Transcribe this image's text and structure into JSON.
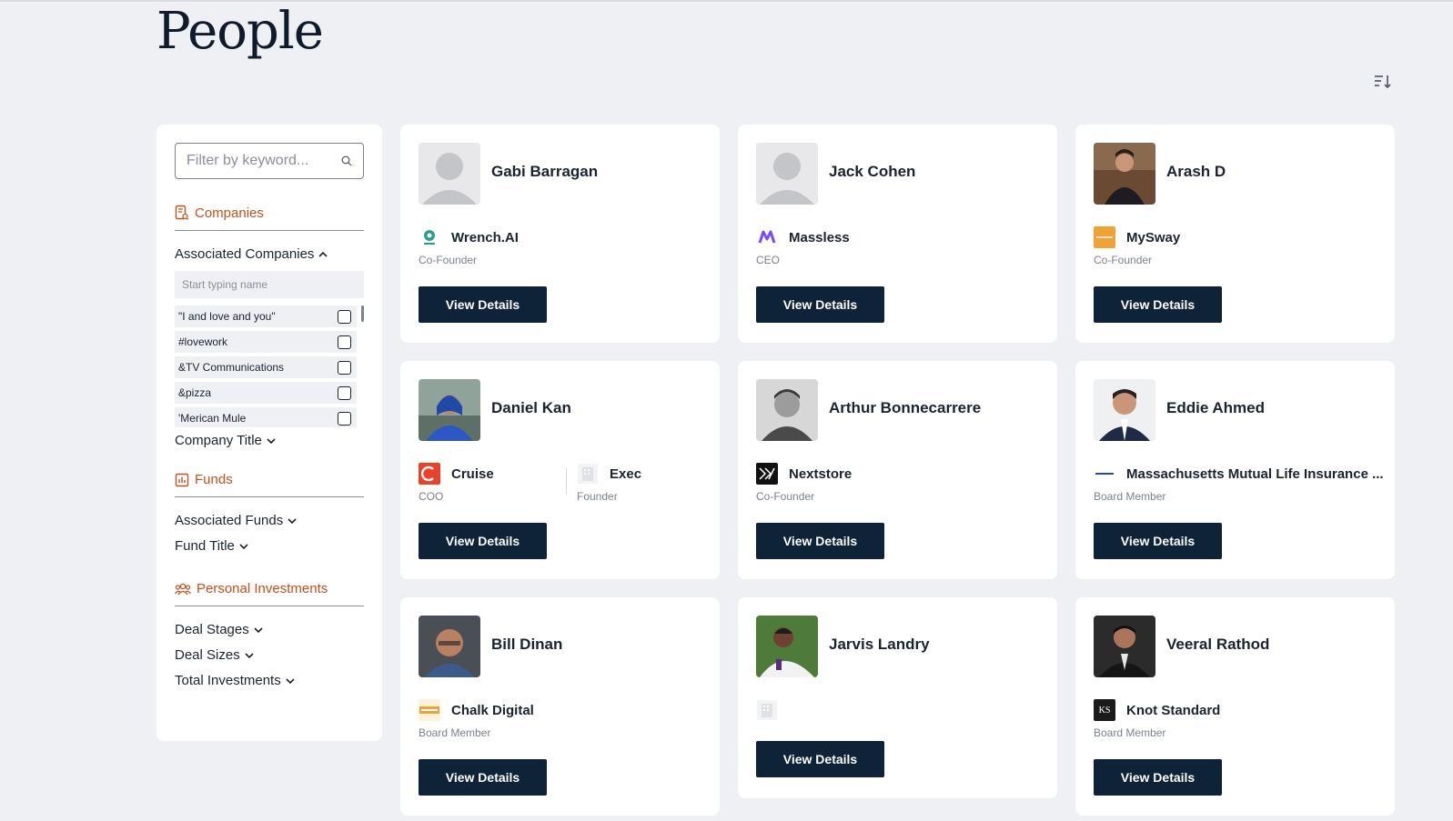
{
  "page": {
    "title": "People",
    "sort_icon": "sort-descending-icon"
  },
  "sidebar": {
    "search_placeholder": "Filter by keyword...",
    "companies": {
      "heading": "Companies",
      "associated_companies_label": "Associated Companies",
      "typing_placeholder": "Start typing name",
      "list": [
        "\"I and love and you\"",
        "#lovework",
        "&TV Communications",
        "&pizza",
        "'Merican Mule"
      ],
      "company_title_label": "Company Title"
    },
    "funds": {
      "heading": "Funds",
      "associated_funds_label": "Associated Funds",
      "fund_title_label": "Fund Title"
    },
    "personal_investments": {
      "heading": "Personal Investments",
      "deal_stages_label": "Deal Stages",
      "deal_sizes_label": "Deal Sizes",
      "total_investments_label": "Total Investments"
    }
  },
  "button_label": "View Details",
  "people": [
    {
      "name": "Gabi Barragan",
      "company": "Wrench.AI",
      "title": "Co-Founder"
    },
    {
      "name": "Jack Cohen",
      "company": "Massless",
      "title": "CEO"
    },
    {
      "name": "Arash D",
      "company": "MySway",
      "title": "Co-Founder"
    },
    {
      "name": "Daniel Kan",
      "company": "Cruise",
      "title": "COO",
      "company2": "Exec",
      "title2": "Founder"
    },
    {
      "name": "Arthur Bonnecarrere",
      "company": "Nextstore",
      "title": "Co-Founder"
    },
    {
      "name": "Eddie Ahmed",
      "company": "Massachusetts Mutual Life Insurance ...",
      "title": "Board Member"
    },
    {
      "name": "Bill Dinan",
      "company": "Chalk Digital",
      "title": "Board Member"
    },
    {
      "name": "Jarvis Landry"
    },
    {
      "name": "Veeral Rathod",
      "company": "Knot Standard",
      "title": "Board Member",
      "logo_text": "KS"
    }
  ],
  "colors": {
    "accent": "#c4501c",
    "button": "#0e2238",
    "background": "#eff0f3"
  }
}
